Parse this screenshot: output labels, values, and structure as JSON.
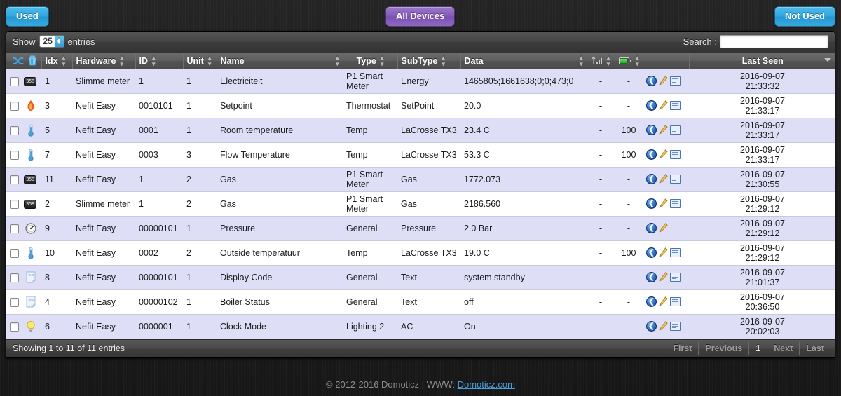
{
  "topbar": {
    "used_label": "Used",
    "all_devices_label": "All Devices",
    "not_used_label": "Not Used",
    "colors": {
      "blue": "#31a6dd",
      "purple": "#8159b8"
    }
  },
  "controls": {
    "show_label": "Show",
    "entries_label": "entries",
    "page_length": "25",
    "search_label": "Search :",
    "search_value": "",
    "search_placeholder": ""
  },
  "table": {
    "headers": {
      "shuffle_icon": "shuffle-icon",
      "trash_icon": "trash-icon",
      "idx": "Idx",
      "hardware": "Hardware",
      "id": "ID",
      "unit": "Unit",
      "name": "Name",
      "type": "Type",
      "subtype": "SubType",
      "data": "Data",
      "signal_icon": "signal-strength-icon",
      "battery_icon": "battery-icon",
      "actions": "",
      "last_seen": "Last Seen"
    },
    "sorted_column": "Last Seen",
    "sort_direction": "desc",
    "rows": [
      {
        "icon": "counter",
        "idx": "1",
        "hardware": "Slimme meter",
        "id": "1",
        "unit": "1",
        "name": "Electriciteit",
        "type": "P1 Smart Meter",
        "subtype": "Energy",
        "data": "1465805;1661638;0;0;473;0",
        "signal": "-",
        "battery": "-",
        "actions": [
          "back",
          "edit",
          "log"
        ],
        "last_seen_date": "2016-09-07",
        "last_seen_time": "21:33:32"
      },
      {
        "icon": "flame",
        "idx": "3",
        "hardware": "Nefit Easy",
        "id": "0010101",
        "unit": "1",
        "name": "Setpoint",
        "type": "Thermostat",
        "subtype": "SetPoint",
        "data": "20.0",
        "signal": "-",
        "battery": "-",
        "actions": [
          "back",
          "edit",
          "log"
        ],
        "last_seen_date": "2016-09-07",
        "last_seen_time": "21:33:17"
      },
      {
        "icon": "therm",
        "idx": "5",
        "hardware": "Nefit Easy",
        "id": "0001",
        "unit": "1",
        "name": "Room temperature",
        "type": "Temp",
        "subtype": "LaCrosse TX3",
        "data": "23.4 C",
        "signal": "-",
        "battery": "100",
        "actions": [
          "back",
          "edit",
          "log"
        ],
        "last_seen_date": "2016-09-07",
        "last_seen_time": "21:33:17"
      },
      {
        "icon": "therm",
        "idx": "7",
        "hardware": "Nefit Easy",
        "id": "0003",
        "unit": "3",
        "name": "Flow Temperature",
        "type": "Temp",
        "subtype": "LaCrosse TX3",
        "data": "53.3 C",
        "signal": "-",
        "battery": "100",
        "actions": [
          "back",
          "edit",
          "log"
        ],
        "last_seen_date": "2016-09-07",
        "last_seen_time": "21:33:17"
      },
      {
        "icon": "counter",
        "idx": "11",
        "hardware": "Nefit Easy",
        "id": "1",
        "unit": "2",
        "name": "Gas",
        "type": "P1 Smart Meter",
        "subtype": "Gas",
        "data": "1772.073",
        "signal": "-",
        "battery": "-",
        "actions": [
          "back",
          "edit",
          "log"
        ],
        "last_seen_date": "2016-09-07",
        "last_seen_time": "21:30:55"
      },
      {
        "icon": "counter",
        "idx": "2",
        "hardware": "Slimme meter",
        "id": "1",
        "unit": "2",
        "name": "Gas",
        "type": "P1 Smart Meter",
        "subtype": "Gas",
        "data": "2186.560",
        "signal": "-",
        "battery": "-",
        "actions": [
          "back",
          "edit",
          "log"
        ],
        "last_seen_date": "2016-09-07",
        "last_seen_time": "21:29:12"
      },
      {
        "icon": "gauge",
        "idx": "9",
        "hardware": "Nefit Easy",
        "id": "00000101",
        "unit": "1",
        "name": "Pressure",
        "type": "General",
        "subtype": "Pressure",
        "data": "2.0 Bar",
        "signal": "-",
        "battery": "-",
        "actions": [
          "back",
          "edit"
        ],
        "last_seen_date": "2016-09-07",
        "last_seen_time": "21:29:12"
      },
      {
        "icon": "therm",
        "idx": "10",
        "hardware": "Nefit Easy",
        "id": "0002",
        "unit": "2",
        "name": "Outside temperatuur",
        "type": "Temp",
        "subtype": "LaCrosse TX3",
        "data": "19.0 C",
        "signal": "-",
        "battery": "100",
        "actions": [
          "back",
          "edit",
          "log"
        ],
        "last_seen_date": "2016-09-07",
        "last_seen_time": "21:29:12"
      },
      {
        "icon": "note",
        "idx": "8",
        "hardware": "Nefit Easy",
        "id": "00000101",
        "unit": "1",
        "name": "Display Code",
        "type": "General",
        "subtype": "Text",
        "data": "system standby",
        "signal": "-",
        "battery": "-",
        "actions": [
          "back",
          "edit",
          "log"
        ],
        "last_seen_date": "2016-09-07",
        "last_seen_time": "21:01:37"
      },
      {
        "icon": "note",
        "idx": "4",
        "hardware": "Nefit Easy",
        "id": "00000102",
        "unit": "1",
        "name": "Boiler Status",
        "type": "General",
        "subtype": "Text",
        "data": "off",
        "signal": "-",
        "battery": "-",
        "actions": [
          "back",
          "edit",
          "log"
        ],
        "last_seen_date": "2016-09-07",
        "last_seen_time": "20:36:50"
      },
      {
        "icon": "bulb",
        "idx": "6",
        "hardware": "Nefit Easy",
        "id": "0000001",
        "unit": "1",
        "name": "Clock Mode",
        "type": "Lighting 2",
        "subtype": "AC",
        "data": "On",
        "signal": "-",
        "battery": "-",
        "actions": [
          "back",
          "edit",
          "log"
        ],
        "last_seen_date": "2016-09-07",
        "last_seen_time": "20:02:03"
      }
    ]
  },
  "footer": {
    "info": "Showing 1 to 11 of 11 entries",
    "pager": [
      "First",
      "Previous",
      "1",
      "Next",
      "Last"
    ],
    "current_page": "1"
  },
  "copyright": {
    "text": "© 2012-2016 Domoticz | WWW: ",
    "link_text": "Domoticz.com"
  }
}
